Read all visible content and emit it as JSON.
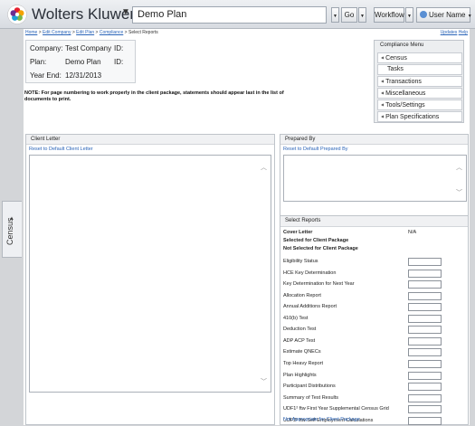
{
  "header": {
    "brand": "Wolters Kluwer",
    "plan_name": "Demo Plan",
    "go_label": "Go",
    "workflow_label": "Workflow",
    "user_label": "User Name"
  },
  "side_tab": {
    "label": "Census"
  },
  "breadcrumb": [
    "Home",
    "Edit Company",
    "Edit Plan",
    "Compliance",
    "Select Reports"
  ],
  "top_links": {
    "updates": "Updates",
    "help": "Help"
  },
  "info": {
    "company_label": "Company:",
    "company_value": "Test Company",
    "company_id_label": "ID:",
    "plan_label": "Plan:",
    "plan_value": "Demo Plan",
    "plan_id_label": "ID:",
    "year_end_label": "Year End:",
    "year_end_value": "12/31/2013"
  },
  "note": "NOTE: For page numbering to work properly in the client package, statements should appear last in the list of documents to print.",
  "compliance_menu": {
    "title": "Compliance Menu",
    "items": [
      "Census",
      "Tasks",
      "Transactions",
      "Miscellaneous",
      "Tools/Settings",
      "Plan Specifications"
    ]
  },
  "client_letter": {
    "title": "Client Letter",
    "reset": "Reset to Default Client Letter"
  },
  "prepared_by": {
    "title": "Prepared By",
    "reset": "Reset to Default Prepared By"
  },
  "select_reports": {
    "title": "Select Reports",
    "cover_letter": "Cover Letter",
    "cover_value": "N/A",
    "selected_heading": "Selected for Client Package",
    "not_selected_heading": "Not Selected for Client Package",
    "reports": [
      "Eligibility Status",
      "HCE Key Determination",
      "Key Determination for Next Year",
      "Allocation Report",
      "Annual Additions Report",
      "410(b) Test",
      "Deduction Test",
      "ADP ACP Test",
      "Estimate QNECs",
      "Top Heavy Report",
      "Plan Highlights",
      "Participant Distributions",
      "Summary of Test Results",
      "UDF1² ftw First Year Supplemental Census Grid",
      "UDF2² ftw Self Employment Calculations"
    ],
    "not_appropriate": "Not Appropriate for Client Package"
  }
}
